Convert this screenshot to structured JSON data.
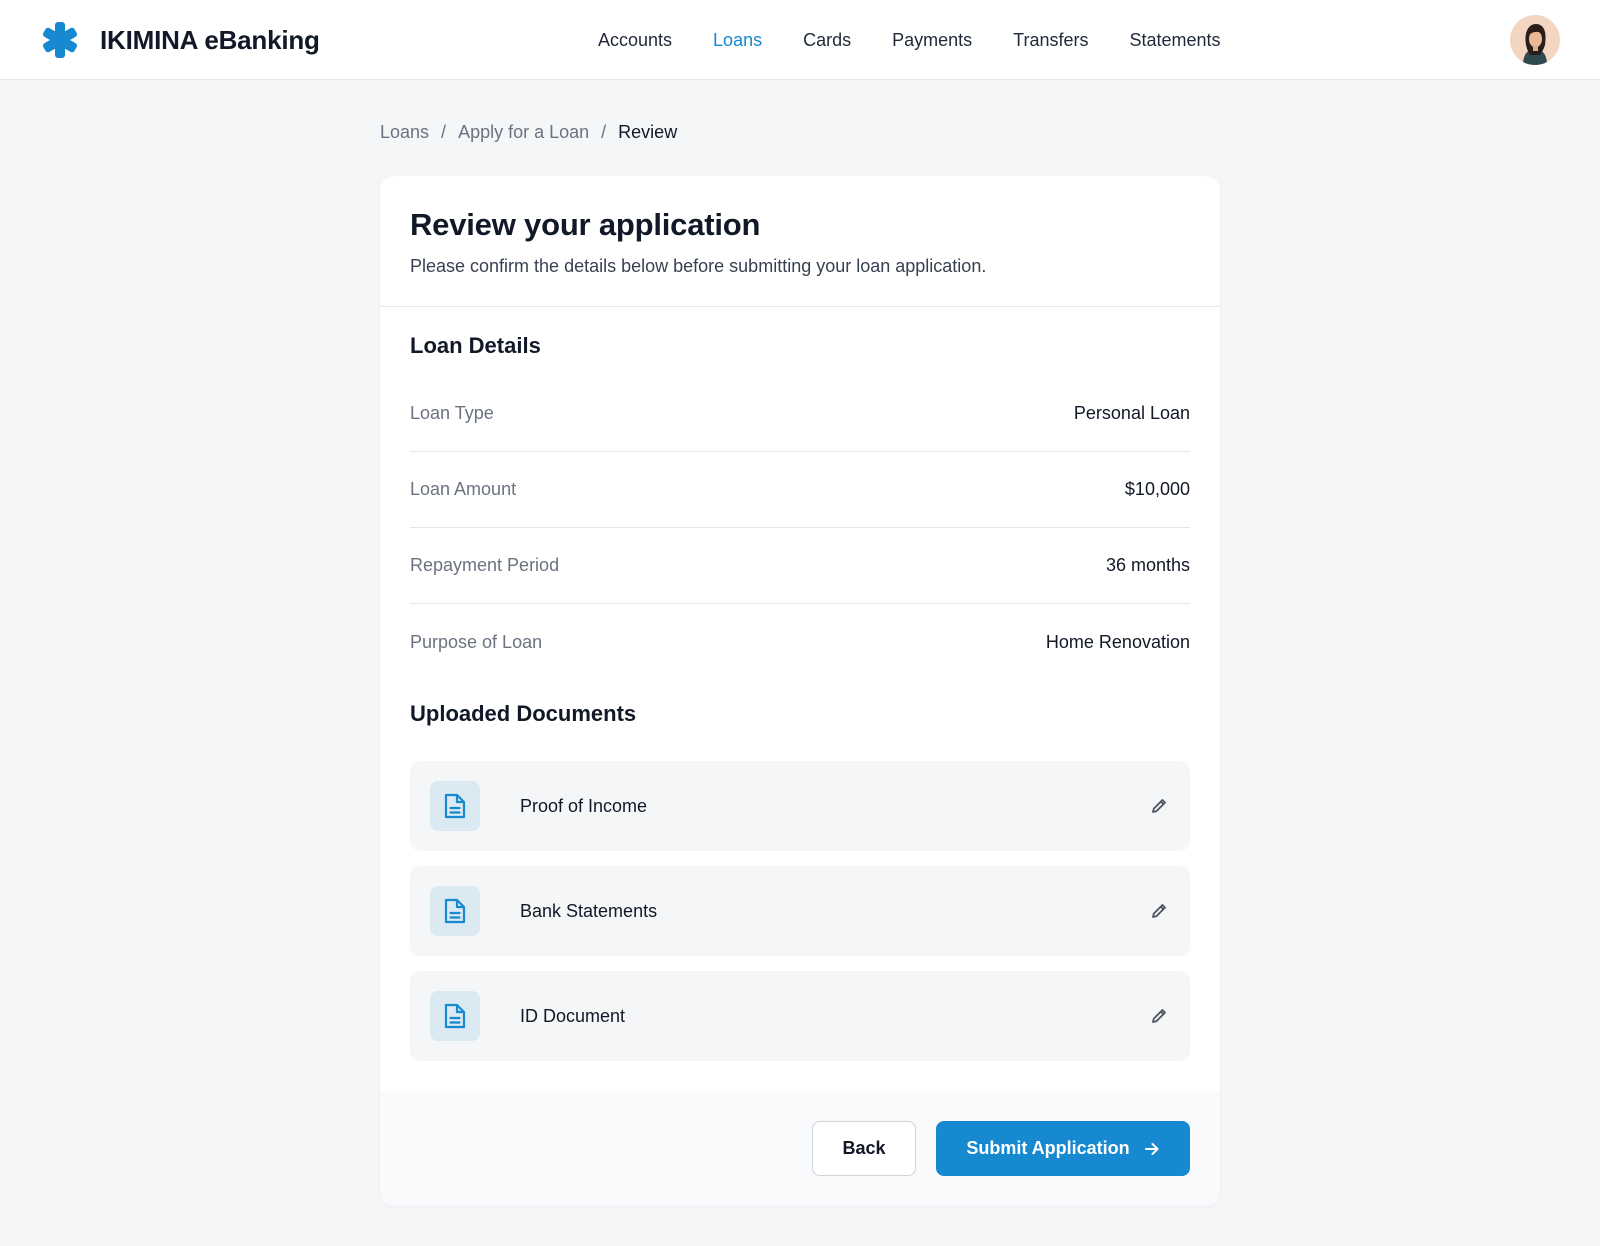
{
  "app": {
    "name": "IKIMINA eBanking",
    "logo_icon": "asterisk-logo-icon",
    "brand_color": "#1689d0"
  },
  "nav": {
    "items": [
      {
        "label": "Accounts",
        "active": false
      },
      {
        "label": "Loans",
        "active": true
      },
      {
        "label": "Cards",
        "active": false
      },
      {
        "label": "Payments",
        "active": false
      },
      {
        "label": "Transfers",
        "active": false
      },
      {
        "label": "Statements",
        "active": false
      }
    ],
    "avatar_icon": "user-avatar"
  },
  "breadcrumb": {
    "items": [
      "Loans",
      "Apply for a Loan"
    ],
    "current": "Review",
    "separator": "/"
  },
  "page": {
    "title": "Review your application",
    "subtitle": "Please confirm the details below before submitting your loan application."
  },
  "loan_details": {
    "heading": "Loan Details",
    "rows": [
      {
        "label": "Loan Type",
        "value": "Personal Loan"
      },
      {
        "label": "Loan Amount",
        "value": "$10,000"
      },
      {
        "label": "Repayment Period",
        "value": "36 months"
      },
      {
        "label": "Purpose of Loan",
        "value": "Home Renovation"
      }
    ]
  },
  "documents": {
    "heading": "Uploaded Documents",
    "items": [
      {
        "name": "Proof of Income",
        "icon": "document-icon",
        "action_icon": "pencil-edit-icon"
      },
      {
        "name": "Bank Statements",
        "icon": "document-icon",
        "action_icon": "pencil-edit-icon"
      },
      {
        "name": "ID Document",
        "icon": "document-icon",
        "action_icon": "pencil-edit-icon"
      }
    ]
  },
  "actions": {
    "back_label": "Back",
    "submit_label": "Submit Application",
    "submit_icon": "arrow-right-icon"
  }
}
